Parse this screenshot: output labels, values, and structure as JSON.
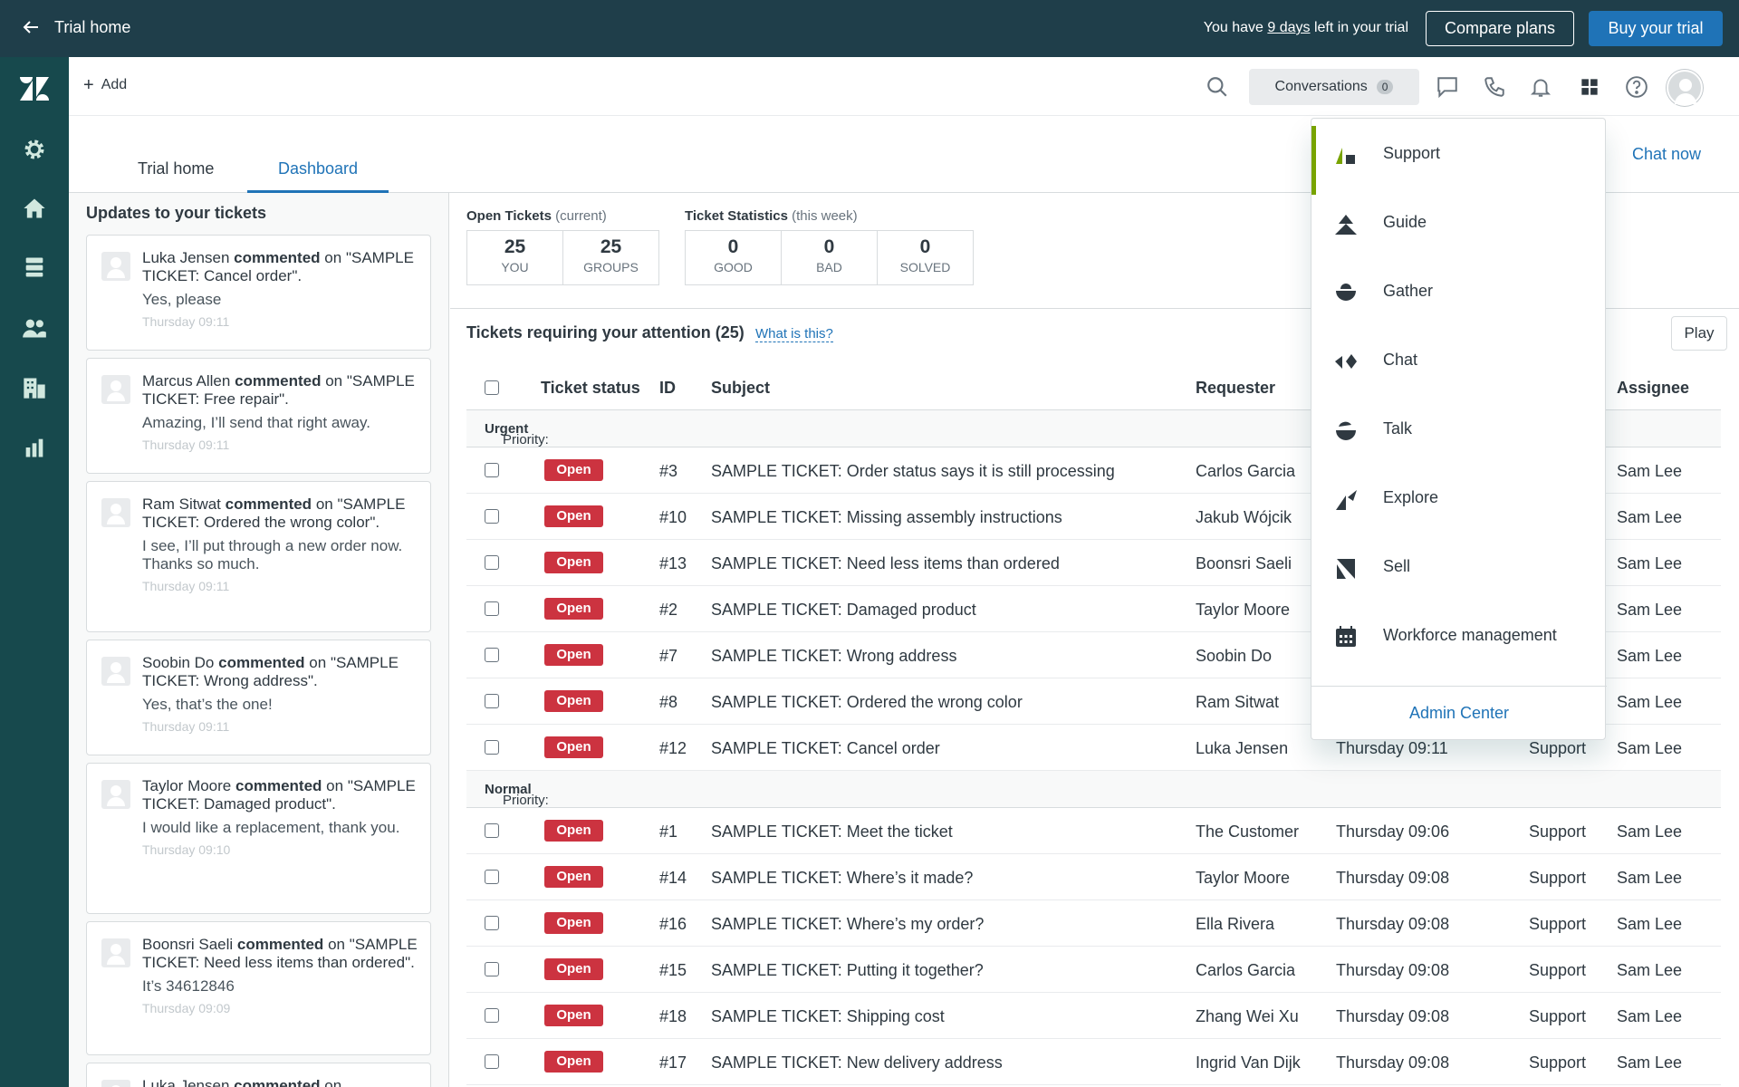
{
  "topbar": {
    "back_label": "Trial home",
    "trial_prefix": "You have ",
    "trial_days": "9 days",
    "trial_suffix": " left in your trial",
    "compare_label": "Compare plans",
    "buy_label": "Buy your trial"
  },
  "header": {
    "add_label": "Add",
    "conversations_label": "Conversations",
    "conversations_count": "0"
  },
  "tabs": [
    {
      "label": "Trial home"
    },
    {
      "label": "Dashboard"
    }
  ],
  "chat_now_label": "Chat now",
  "updates": {
    "title": "Updates to your tickets",
    "items": [
      {
        "name": "Luka Jensen",
        "action": "commented",
        "on": "on",
        "ticket": "\"SAMPLE TICKET: Cancel order\".",
        "message": "Yes, please",
        "time": "Thursday 09:11"
      },
      {
        "name": "Marcus Allen",
        "action": "commented",
        "on": "on",
        "ticket": "\"SAMPLE TICKET: Free repair\".",
        "message": "Amazing, I’ll send that right away.",
        "time": "Thursday 09:11"
      },
      {
        "name": "Ram Sitwat",
        "action": "commented",
        "on": "on",
        "ticket": "\"SAMPLE TICKET: Ordered the wrong color\".",
        "message": "I see, I’ll put through a new order now. Thanks so much.",
        "time": "Thursday 09:11"
      },
      {
        "name": "Soobin Do",
        "action": "commented",
        "on": "on",
        "ticket": "\"SAMPLE TICKET: Wrong address\".",
        "message": "Yes, that’s the one!",
        "time": "Thursday 09:11"
      },
      {
        "name": "Taylor Moore",
        "action": "commented",
        "on": "on",
        "ticket": "\"SAMPLE TICKET: Damaged product\".",
        "message": "I would like a replacement, thank you.",
        "time": "Thursday 09:10"
      },
      {
        "name": "Boonsri Saeli",
        "action": "commented",
        "on": "on",
        "ticket": "\"SAMPLE TICKET: Need less items than ordered\".",
        "message": "It’s 34612846",
        "time": "Thursday 09:09"
      },
      {
        "name": "Luka Jensen",
        "action": "commented",
        "on": "on",
        "ticket": "",
        "message": "",
        "time": ""
      }
    ]
  },
  "stats": {
    "open_title": "Open Tickets",
    "open_sub": "(current)",
    "open": [
      {
        "value": "25",
        "label": "YOU"
      },
      {
        "value": "25",
        "label": "GROUPS"
      }
    ],
    "ticket_title": "Ticket Statistics",
    "ticket_sub": "(this week)",
    "ticket": [
      {
        "value": "0",
        "label": "GOOD"
      },
      {
        "value": "0",
        "label": "BAD"
      },
      {
        "value": "0",
        "label": "SOLVED"
      }
    ]
  },
  "attention": {
    "title": "Tickets requiring your attention (25)",
    "what_is_this": "What is this?",
    "play_label": "Play"
  },
  "table": {
    "headers": {
      "status": "Ticket status",
      "id": "ID",
      "subject": "Subject",
      "requester": "Requester",
      "assignee": "Assignee"
    },
    "priority_prefix": "Priority:",
    "urgent_label": "Urgent",
    "normal_label": "Normal",
    "urgent_rows": [
      {
        "status": "Open",
        "id": "#3",
        "subject": "SAMPLE TICKET: Order status says it is still processing",
        "requester": "Carlos Garcia",
        "updated": "",
        "group": "",
        "assignee": "Sam Lee"
      },
      {
        "status": "Open",
        "id": "#10",
        "subject": "SAMPLE TICKET: Missing assembly instructions",
        "requester": "Jakub Wójcik",
        "updated": "",
        "group": "",
        "assignee": "Sam Lee"
      },
      {
        "status": "Open",
        "id": "#13",
        "subject": "SAMPLE TICKET: Need less items than ordered",
        "requester": "Boonsri Saeli",
        "updated": "",
        "group": "",
        "assignee": "Sam Lee"
      },
      {
        "status": "Open",
        "id": "#2",
        "subject": "SAMPLE TICKET: Damaged product",
        "requester": "Taylor Moore",
        "updated": "",
        "group": "",
        "assignee": "Sam Lee"
      },
      {
        "status": "Open",
        "id": "#7",
        "subject": "SAMPLE TICKET: Wrong address",
        "requester": "Soobin Do",
        "updated": "",
        "group": "",
        "assignee": "Sam Lee"
      },
      {
        "status": "Open",
        "id": "#8",
        "subject": "SAMPLE TICKET: Ordered the wrong color",
        "requester": "Ram Sitwat",
        "updated": "",
        "group": "",
        "assignee": "Sam Lee"
      },
      {
        "status": "Open",
        "id": "#12",
        "subject": "SAMPLE TICKET: Cancel order",
        "requester": "Luka Jensen",
        "updated": "Thursday 09:11",
        "group": "Support",
        "assignee": "Sam Lee"
      }
    ],
    "normal_rows": [
      {
        "status": "Open",
        "id": "#1",
        "subject": "SAMPLE TICKET: Meet the ticket",
        "requester": "The Customer",
        "updated": "Thursday 09:06",
        "group": "Support",
        "assignee": "Sam Lee"
      },
      {
        "status": "Open",
        "id": "#14",
        "subject": "SAMPLE TICKET: Where’s it made?",
        "requester": "Taylor Moore",
        "updated": "Thursday 09:08",
        "group": "Support",
        "assignee": "Sam Lee"
      },
      {
        "status": "Open",
        "id": "#16",
        "subject": "SAMPLE TICKET: Where’s my order?",
        "requester": "Ella Rivera",
        "updated": "Thursday 09:08",
        "group": "Support",
        "assignee": "Sam Lee"
      },
      {
        "status": "Open",
        "id": "#15",
        "subject": "SAMPLE TICKET: Putting it together?",
        "requester": "Carlos Garcia",
        "updated": "Thursday 09:08",
        "group": "Support",
        "assignee": "Sam Lee"
      },
      {
        "status": "Open",
        "id": "#18",
        "subject": "SAMPLE TICKET: Shipping cost",
        "requester": "Zhang Wei Xu",
        "updated": "Thursday 09:08",
        "group": "Support",
        "assignee": "Sam Lee"
      },
      {
        "status": "Open",
        "id": "#17",
        "subject": "SAMPLE TICKET: New delivery address",
        "requester": "Ingrid Van Dijk",
        "updated": "Thursday 09:08",
        "group": "Support",
        "assignee": "Sam Lee"
      }
    ]
  },
  "product_menu": {
    "items": [
      {
        "label": "Support",
        "icon": "support-icon"
      },
      {
        "label": "Guide",
        "icon": "guide-icon"
      },
      {
        "label": "Gather",
        "icon": "gather-icon"
      },
      {
        "label": "Chat",
        "icon": "chat-icon"
      },
      {
        "label": "Talk",
        "icon": "talk-icon"
      },
      {
        "label": "Explore",
        "icon": "explore-icon"
      },
      {
        "label": "Sell",
        "icon": "sell-icon"
      },
      {
        "label": "Workforce management",
        "icon": "workforce-icon"
      }
    ],
    "footer_label": "Admin Center"
  },
  "colors": {
    "topbar_bg": "#1f3e4a",
    "nav_bg": "#17494d",
    "accent_blue": "#1f73b7",
    "open_badge": "#cc3340",
    "active_marker": "#78a300"
  }
}
